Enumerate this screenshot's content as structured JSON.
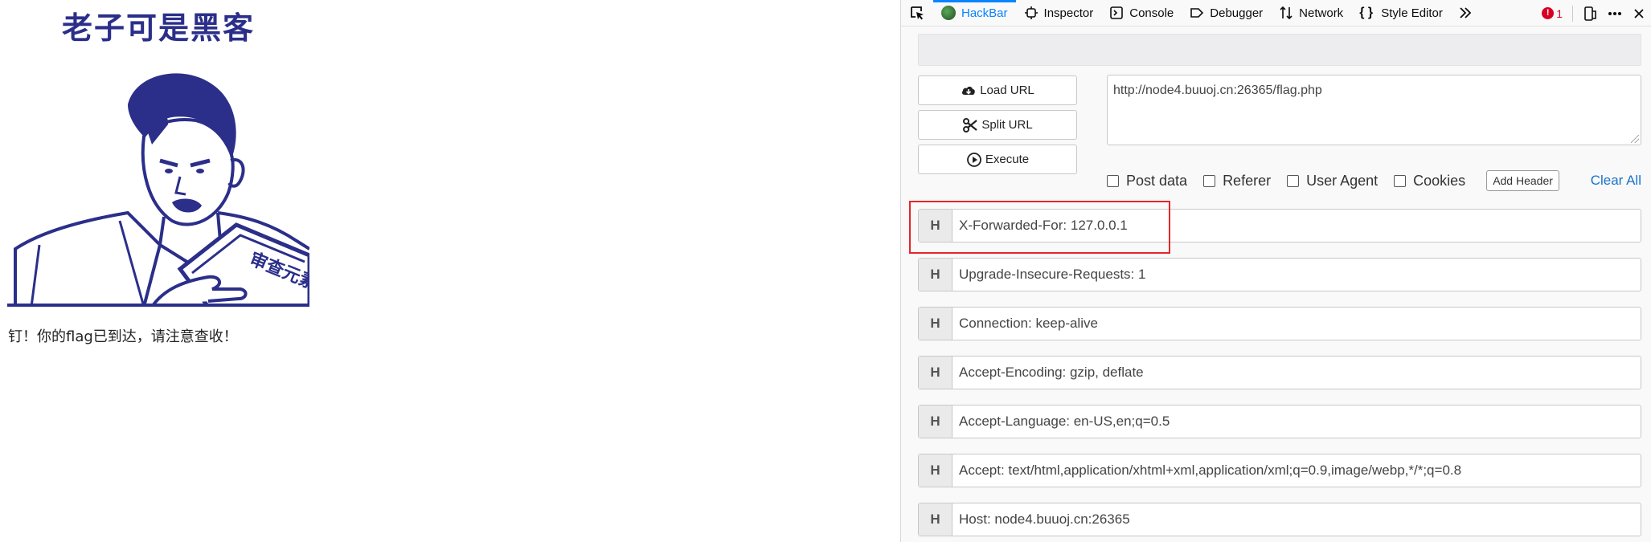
{
  "page": {
    "meme_title": "老子可是黑客",
    "meme_book_text": "审查元素",
    "message": "钉！你的flag已到达，请注意查收！"
  },
  "devtools": {
    "toolbar": {
      "tabs": [
        {
          "label": "HackBar",
          "icon": "hackbar-icon",
          "active": true
        },
        {
          "label": "Inspector",
          "icon": "inspector-icon"
        },
        {
          "label": "Console",
          "icon": "console-icon"
        },
        {
          "label": "Debugger",
          "icon": "debugger-icon"
        },
        {
          "label": "Network",
          "icon": "network-icon"
        },
        {
          "label": "Style Editor",
          "icon": "style-editor-icon"
        }
      ],
      "error_count": "1",
      "accent": "#0a84ff"
    },
    "hackbar": {
      "load_url_label": "Load URL",
      "split_url_label": "Split URL",
      "execute_label": "Execute",
      "url_value": "http://node4.buuoj.cn:26365/flag.php",
      "options": {
        "post_data": "Post data",
        "referer": "Referer",
        "user_agent": "User Agent",
        "cookies": "Cookies"
      },
      "add_header_label": "Add Header",
      "clear_all_label": "Clear All",
      "header_badge": "H",
      "headers": [
        "X-Forwarded-For: 127.0.0.1",
        "Upgrade-Insecure-Requests: 1",
        "Connection: keep-alive",
        "Accept-Encoding: gzip, deflate",
        "Accept-Language: en-US,en;q=0.5",
        "Accept: text/html,application/xhtml+xml,application/xml;q=0.9,image/webp,*/*;q=0.8",
        "Host: node4.buuoj.cn:26365"
      ],
      "highlight_color": "#e5262a"
    }
  }
}
